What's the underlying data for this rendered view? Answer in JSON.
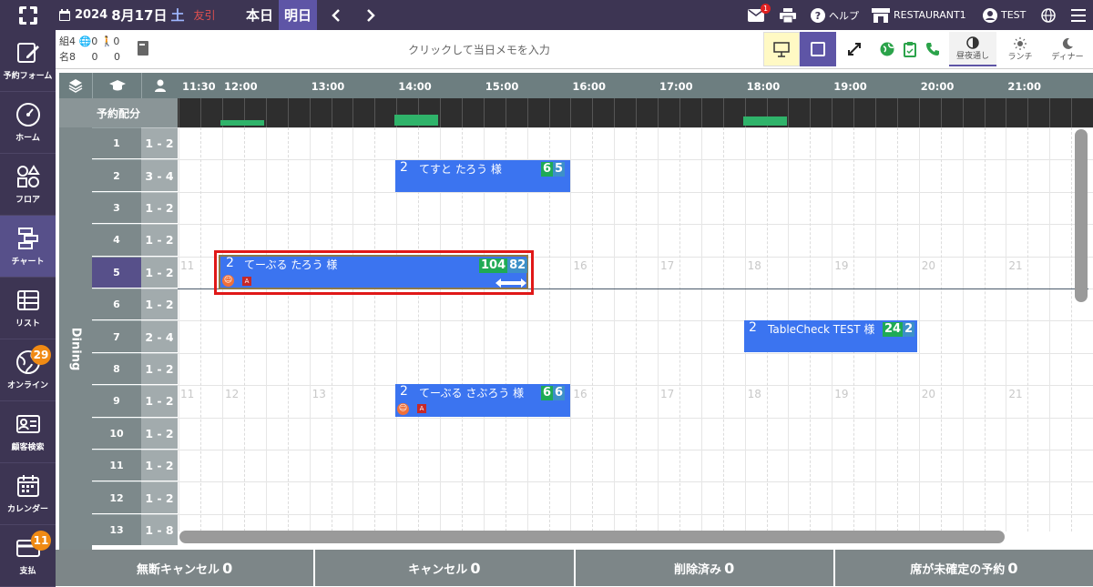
{
  "topbar": {
    "year": "2024",
    "date": "8月17日",
    "weekday": "土",
    "rokuyo": "友引",
    "today_label": "本日",
    "tomorrow_label": "明日",
    "help_label": "ヘルプ",
    "restaurant": "RESTAURANT1",
    "user": "TEST",
    "mail_badge": "1"
  },
  "sidebar": {
    "items": [
      {
        "label": "予約フォーム"
      },
      {
        "label": "ホーム"
      },
      {
        "label": "フロア"
      },
      {
        "label": "チャート"
      },
      {
        "label": "リスト"
      },
      {
        "label": "オンライン",
        "badge": "29"
      },
      {
        "label": "顧客検索"
      },
      {
        "label": "カレンダー"
      },
      {
        "label": "支払",
        "badge": "11"
      }
    ]
  },
  "toolbar": {
    "stat_groups": "組",
    "stat_groups_val": "4",
    "stat_web_val": "0",
    "stat_walk_val": "0",
    "stat_people": "名",
    "stat_people_val": "8",
    "stat_web2_val": "0",
    "stat_walk2_val": "0",
    "memo_placeholder": "クリックして当日メモを入力",
    "mode_all": "昼夜通し",
    "mode_lunch": "ランチ",
    "mode_dinner": "ディナー"
  },
  "grid": {
    "allocation_label": "予約配分",
    "section_label": "Dining",
    "times": [
      "11:30",
      "12:00",
      "13:00",
      "14:00",
      "15:00",
      "16:00",
      "17:00",
      "18:00",
      "19:00",
      "20:00",
      "21:00"
    ],
    "faint_hours": [
      "11",
      "12",
      "13",
      "14",
      "15",
      "16",
      "17",
      "18",
      "19",
      "20",
      "21"
    ],
    "tables": [
      {
        "name": "1",
        "cap": "1 - 2"
      },
      {
        "name": "2",
        "cap": "3 - 4"
      },
      {
        "name": "3",
        "cap": "1 - 2"
      },
      {
        "name": "4",
        "cap": "1 - 2"
      },
      {
        "name": "5",
        "cap": "1 - 2"
      },
      {
        "name": "6",
        "cap": "1 - 2"
      },
      {
        "name": "7",
        "cap": "2 - 4"
      },
      {
        "name": "8",
        "cap": "1 - 2"
      },
      {
        "name": "9",
        "cap": "1 - 2"
      },
      {
        "name": "10",
        "cap": "1 - 2"
      },
      {
        "name": "11",
        "cap": "1 - 2"
      },
      {
        "name": "12",
        "cap": "1 - 2"
      },
      {
        "name": "13",
        "cap": "1 - 8"
      }
    ]
  },
  "reservations": [
    {
      "people": "2",
      "name": "てすと たろう 様",
      "count_a": "6",
      "count_b": "5"
    },
    {
      "people": "2",
      "name": "てーぶる たろう 様",
      "count_a": "104",
      "count_b": "82"
    },
    {
      "people": "2",
      "name": "TableCheck TEST 様",
      "count_a": "24",
      "count_b": "2"
    },
    {
      "people": "2",
      "name": "てーぶる さぶろう 様",
      "count_a": "6",
      "count_b": "6"
    }
  ],
  "footer": {
    "noshow_label": "無断キャンセル",
    "noshow_val": "0",
    "cancel_label": "キャンセル",
    "cancel_val": "0",
    "deleted_label": "削除済み",
    "deleted_val": "0",
    "unassigned_label": "席が未確定の予約",
    "unassigned_val": "0"
  },
  "colors": {
    "nav_bg": "#3d3553",
    "reservation": "#3b74f0",
    "allocation_bar": "#2fb36a",
    "highlight": "#e01818"
  }
}
